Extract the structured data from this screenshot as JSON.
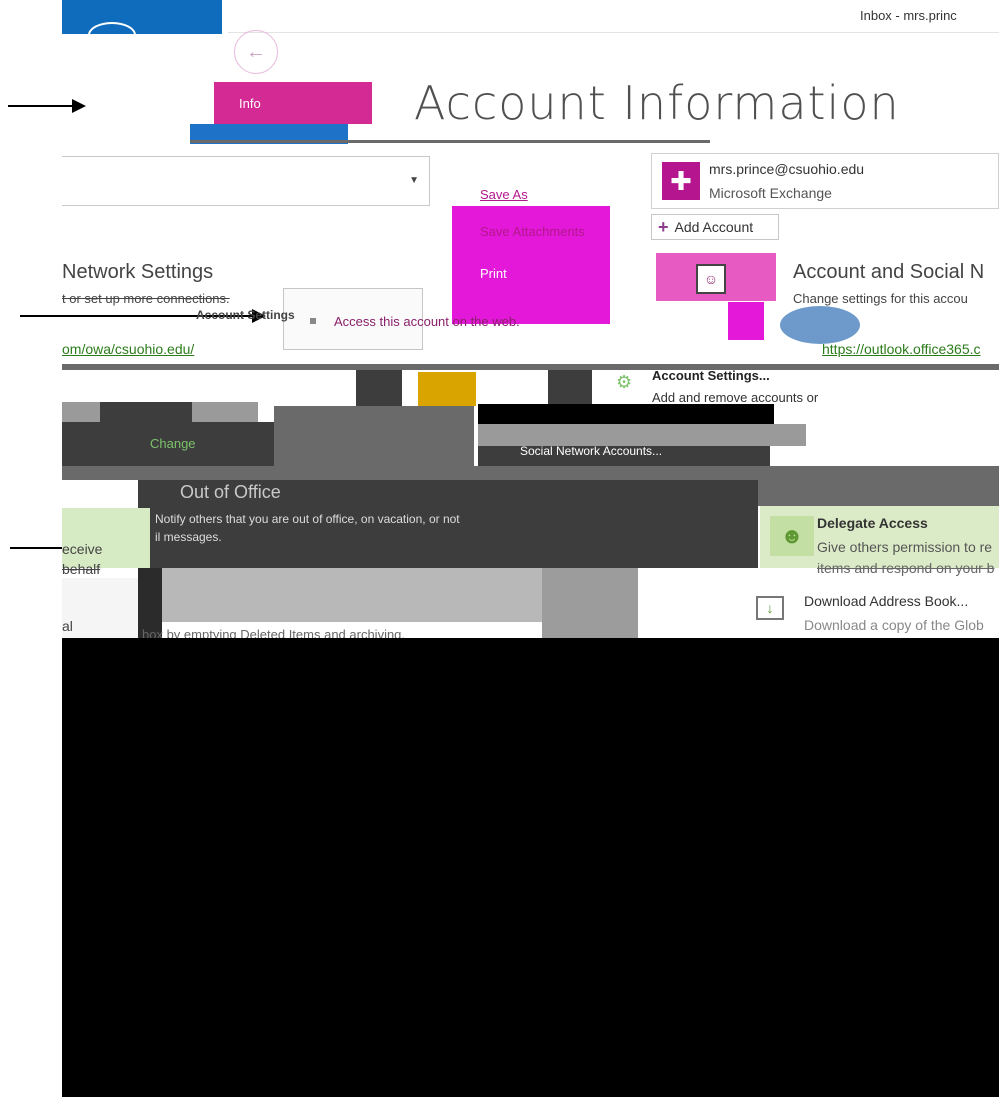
{
  "window": {
    "title": "Inbox - mrs.princ"
  },
  "backstage": {
    "back_icon": "back-arrow-icon",
    "nav_info_label": "Info",
    "page_title": "Account Information"
  },
  "file_menu": {
    "save_as": "Save As",
    "save_attachments": "Save Attachments",
    "print": "Print"
  },
  "account": {
    "email": "mrs.prince@csuohio.edu",
    "type": "Microsoft Exchange",
    "add_account": "Add Account"
  },
  "network_settings": {
    "heading": "Network Settings",
    "description": "t or set up more connections.",
    "button_label": "Account Settings",
    "web_access_hint": "Access this account on the web.",
    "owa_link": "om/owa/csuohio.edu/"
  },
  "social_settings": {
    "heading": "Account and Social N",
    "description": "Change settings for this accou",
    "url": "https://outlook.office365.c"
  },
  "settings_menu": {
    "account_settings": "Account Settings...",
    "account_settings_desc": "Add and remove accounts or",
    "social_network_accounts": "Social Network Accounts..."
  },
  "change_label": "Change",
  "out_of_office": {
    "title": "Out of Office",
    "description_line1": "Notify others that you are out of office, on vacation, or not",
    "description_line2": "il messages."
  },
  "left_fragments": {
    "receive": "eceive",
    "behalf": "behalf",
    "al": "al"
  },
  "cleanup_text": "box by emptying Deleted Items and archiving.",
  "delegate": {
    "title": "Delegate Access",
    "description": "Give others permission to re",
    "description2": "items and respond on your b"
  },
  "address_book": {
    "title": "Download Address Book...",
    "description": "Download a copy of the Glob"
  },
  "colors": {
    "nav_active": "#d42a94",
    "menu_magenta": "#e318d9",
    "link_green": "#2b7c1a",
    "delegate_bg": "#dcebc7"
  }
}
